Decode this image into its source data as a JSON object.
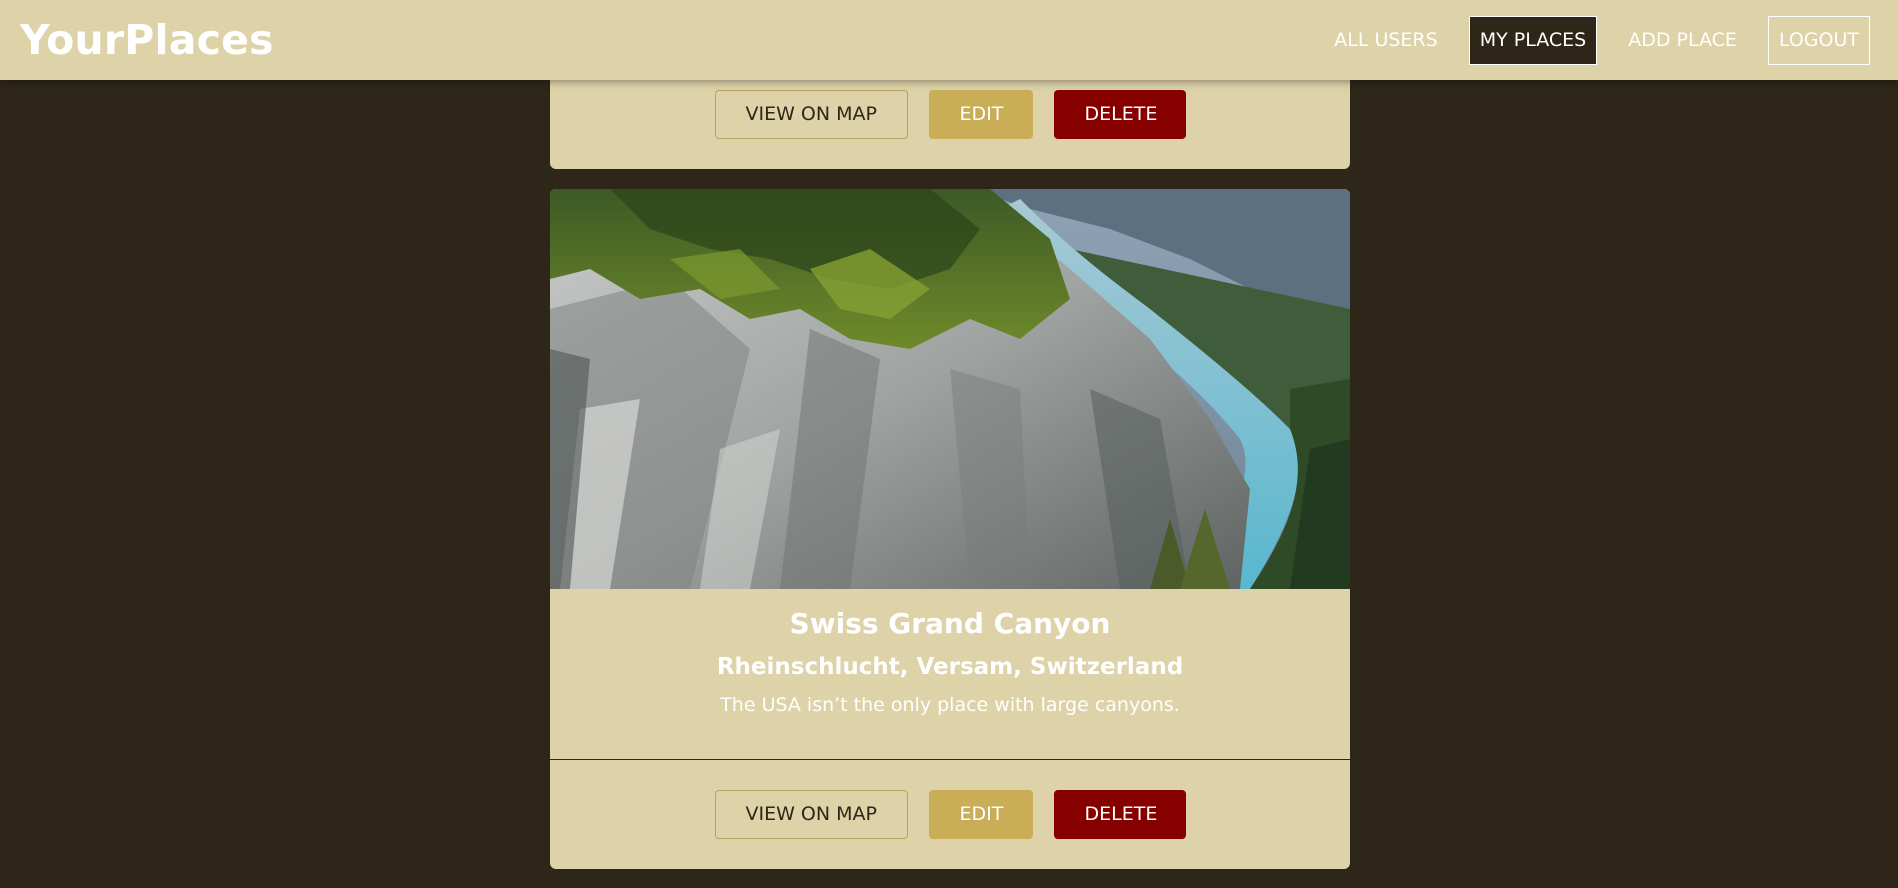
{
  "header": {
    "brand": "YourPlaces",
    "nav": {
      "all_users": "ALL USERS",
      "my_places": "MY PLACES",
      "add_place": "ADD PLACE",
      "logout": "LOGOUT"
    }
  },
  "cards": [
    {
      "actions": {
        "view": "VIEW ON MAP",
        "edit": "EDIT",
        "delete": "DELETE"
      }
    },
    {
      "image_alt": "Swiss Grand Canyon",
      "title": "Swiss Grand Canyon",
      "address": "Rheinschlucht, Versam, Switzerland",
      "description": "The USA isn’t the only place with large canyons.",
      "actions": {
        "view": "VIEW ON MAP",
        "edit": "EDIT",
        "delete": "DELETE"
      }
    }
  ],
  "colors": {
    "page_bg": "#2e2619",
    "header_bg": "#ddd2a8",
    "card_bg": "#ddd2a8",
    "edit_button": "#c9ad57",
    "delete_button": "#870000"
  }
}
